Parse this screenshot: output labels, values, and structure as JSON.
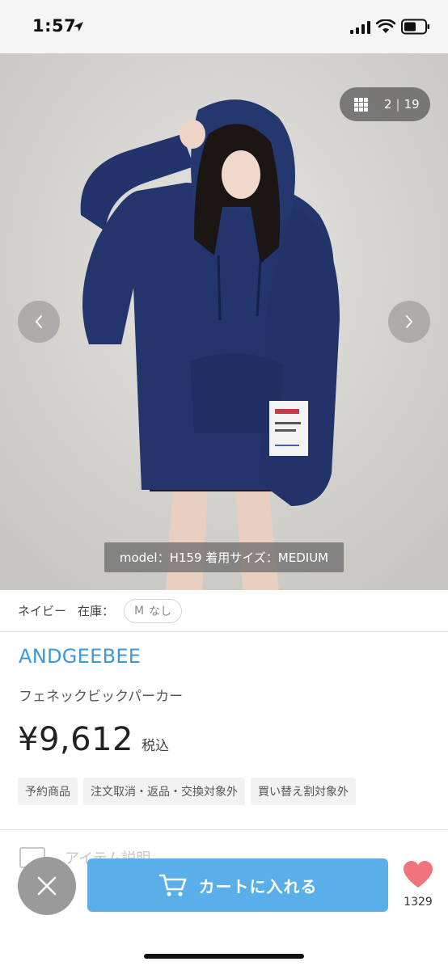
{
  "status_bar": {
    "time": "1:57"
  },
  "gallery": {
    "current": "2",
    "separator": "|",
    "total": "19",
    "caption": "model：H159 着用サイズ：MEDIUM"
  },
  "variant": {
    "color": "ネイビー",
    "stock_label": "在庫：",
    "size": "M",
    "availability": "なし"
  },
  "product": {
    "brand": "ANDGEEBEE",
    "name": "フェネックビックパーカー",
    "price": "¥9,612",
    "tax_label": "税込",
    "tags": [
      "予約商品",
      "注文取消・返品・交換対象外",
      "買い替え割対象外"
    ]
  },
  "description_label": "アイテム説明",
  "actions": {
    "cart_label": "カートに入れる",
    "favorite_count": "1329"
  },
  "colors": {
    "accent": "#3d98d6",
    "cart_button": "#5aaee9",
    "heart": "#f0757a"
  }
}
